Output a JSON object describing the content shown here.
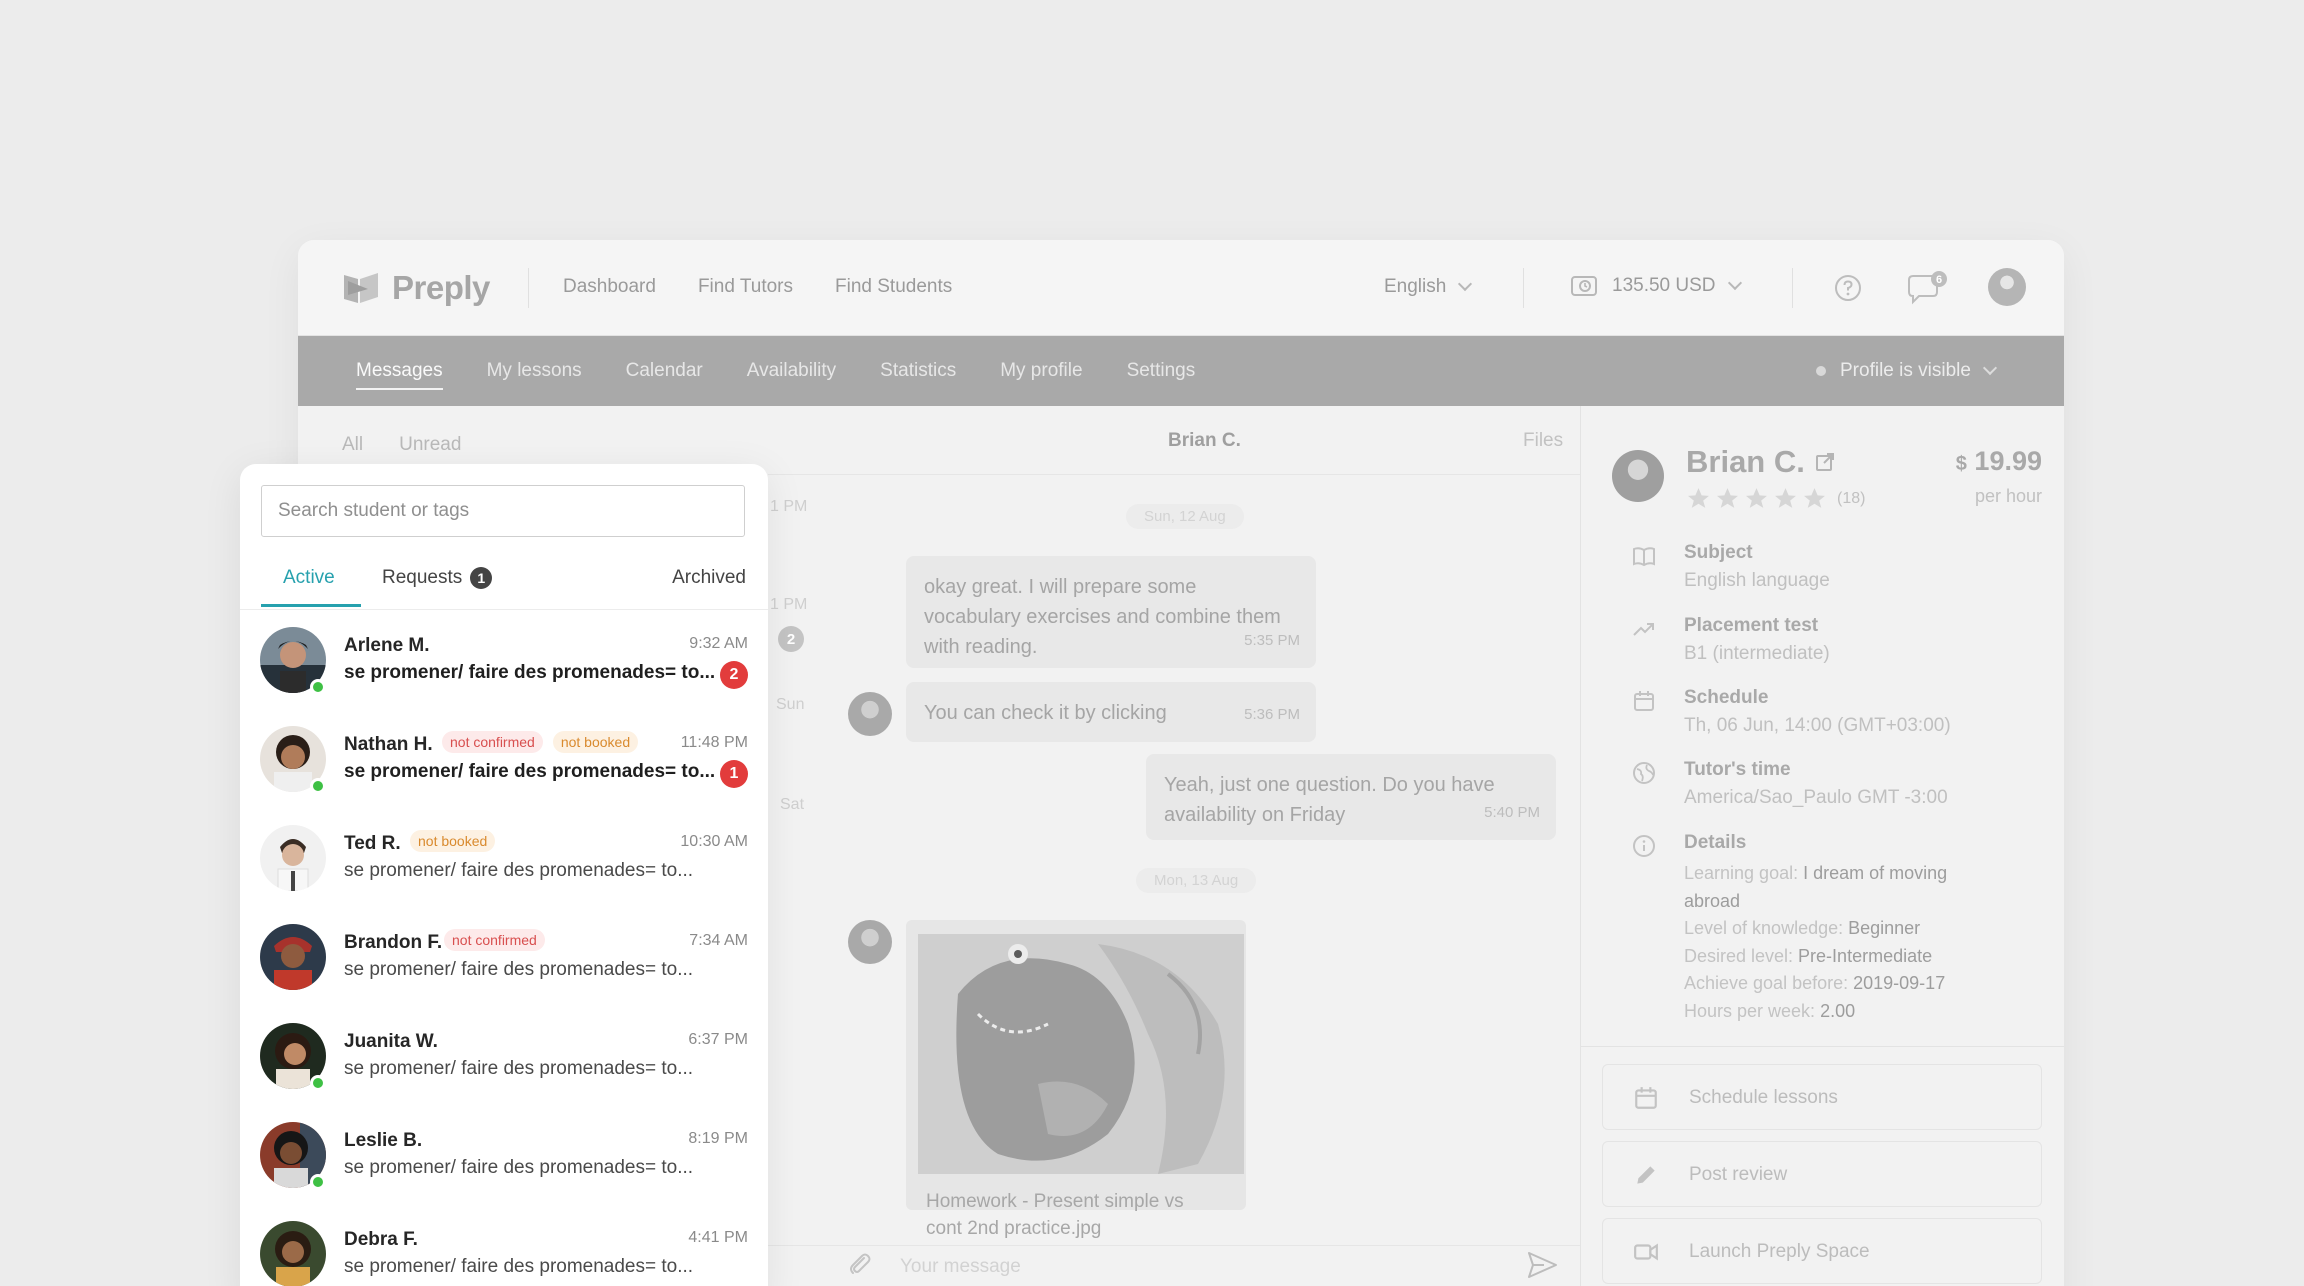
{
  "brand": {
    "name": "Preply"
  },
  "top_nav": {
    "items": [
      "Dashboard",
      "Find Tutors",
      "Find Students"
    ]
  },
  "language": {
    "label": "English"
  },
  "wallet": {
    "balance": "135.50 USD"
  },
  "notifications": {
    "message_count": "6"
  },
  "sub_nav": {
    "items": [
      "Messages",
      "My lessons",
      "Calendar",
      "Availability",
      "Statistics",
      "My profile",
      "Settings"
    ],
    "active": "Messages",
    "profile_visibility": "Profile is visible"
  },
  "filters": {
    "all": "All",
    "unread": "Unread"
  },
  "left_column_fragments": {
    "time_a": "1 PM",
    "time_b": "1 PM",
    "badge": "2",
    "day_a": "Sun",
    "day_b": "Sat"
  },
  "chat": {
    "title": "Brian C.",
    "files_label": "Files",
    "day_1": "Sun, 12 Aug",
    "day_2": "Mon, 13 Aug",
    "messages": [
      {
        "text": "okay great. I will prepare some vocabulary exercises and combine them with reading.",
        "time": "5:35 PM",
        "from": "tutor"
      },
      {
        "text": "You can check it by clicking",
        "time": "5:36 PM",
        "from": "tutor"
      },
      {
        "text": "Yeah, just one question. Do you have availability on Friday",
        "time": "5:40 PM",
        "from": "me"
      }
    ],
    "attachment": {
      "name_line1": "Homework - Present simple vs",
      "name_line2": "cont 2nd practice.jpg"
    },
    "composer_placeholder": "Your message"
  },
  "profile": {
    "name": "Brian C.",
    "price": "19.99",
    "currency_symbol": "$",
    "per_hour": "per hour",
    "rating_count": "(18)",
    "stars": 5,
    "subject_label": "Subject",
    "subject_value": "English language",
    "placement_label": "Placement test",
    "placement_value": "B1 (intermediate)",
    "schedule_label": "Schedule",
    "schedule_value": "Th, 06 Jun, 14:00 (GMT+03:00)",
    "tz_label": "Tutor's time",
    "tz_value": "America/Sao_Paulo GMT -3:00",
    "details_label": "Details",
    "details": {
      "goal_key": "Learning goal: ",
      "goal_val_1": "I dream of moving",
      "goal_val_2": "abroad",
      "knowledge_key": "Level of knowledge: ",
      "knowledge_val": "Beginner",
      "desired_key": "Desired level: ",
      "desired_val": "Pre-Intermediate",
      "before_key": "Achieve goal before: ",
      "before_val": "2019-09-17",
      "hours_key": "Hours per week: ",
      "hours_val": "2.00"
    },
    "actions": [
      "Schedule lessons",
      "Post review",
      "Launch Preply Space"
    ]
  },
  "student_panel": {
    "search_placeholder": "Search student or tags",
    "tabs": {
      "active": "Active",
      "requests": "Requests",
      "requests_count": "1",
      "archived": "Archived"
    },
    "tag_labels": {
      "not_confirmed": "not confirmed",
      "not_booked": "not booked"
    },
    "students": [
      {
        "name": "Arlene M.",
        "time": "9:32 AM",
        "preview": "se promener/ faire des promenades= to...",
        "unread": "2",
        "online": true
      },
      {
        "name": "Nathan H.",
        "time": "11:48 PM",
        "preview": "se promener/ faire des promenades= to...",
        "unread": "1",
        "online": true
      },
      {
        "name": "Ted R.",
        "time": "10:30 AM",
        "preview": "se promener/ faire des promenades= to...",
        "unread": null,
        "online": false
      },
      {
        "name": "Brandon F.",
        "time": "7:34 AM",
        "preview": "se promener/ faire des promenades= to...",
        "unread": null,
        "online": false
      },
      {
        "name": "Juanita W.",
        "time": "6:37 PM",
        "preview": "se promener/ faire des promenades= to...",
        "unread": null,
        "online": true
      },
      {
        "name": "Leslie B.",
        "time": "8:19 PM",
        "preview": "se promener/ faire des promenades= to...",
        "unread": null,
        "online": true
      },
      {
        "name": "Debra F.",
        "time": "4:41 PM",
        "preview": "se promener/ faire des promenades= to...",
        "unread": null,
        "online": false
      }
    ]
  },
  "colors": {
    "accent": "#27a1ae",
    "unread": "#e23c3c",
    "online": "#3ec044"
  }
}
